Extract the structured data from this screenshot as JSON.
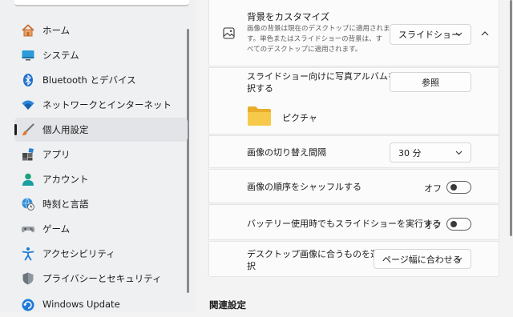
{
  "sidebar": {
    "items": [
      {
        "label": "ホーム",
        "icon": "home-icon"
      },
      {
        "label": "システム",
        "icon": "system-icon"
      },
      {
        "label": "Bluetooth とデバイス",
        "icon": "bluetooth-icon"
      },
      {
        "label": "ネットワークとインターネット",
        "icon": "wifi-icon"
      },
      {
        "label": "個人用設定",
        "icon": "brush-icon",
        "active": true
      },
      {
        "label": "アプリ",
        "icon": "apps-icon"
      },
      {
        "label": "アカウント",
        "icon": "account-icon"
      },
      {
        "label": "時刻と言語",
        "icon": "globe-clock-icon"
      },
      {
        "label": "ゲーム",
        "icon": "gamepad-icon"
      },
      {
        "label": "アクセシビリティ",
        "icon": "accessibility-icon"
      },
      {
        "label": "プライバシーとセキュリティ",
        "icon": "shield-icon"
      },
      {
        "label": "Windows Update",
        "icon": "update-icon"
      }
    ]
  },
  "background": {
    "title": "背景をカスタマイズ",
    "description_lines": [
      "画像の背景は現在のデスクトップに適用されま",
      "す。単色またはスライドショーの背景は、す",
      "べてのデスクトップに適用されます。"
    ],
    "type_value": "スライドショー"
  },
  "album": {
    "label_lines": [
      "スライドショー向けに写真アルバムを選",
      "択する"
    ],
    "browse_label": "参照",
    "folder_name": "ピクチャ"
  },
  "interval": {
    "label": "画像の切り替え間隔",
    "value": "30 分"
  },
  "shuffle": {
    "label": "画像の順序をシャッフルする",
    "state_text": "オフ",
    "on": false
  },
  "battery": {
    "label": "バッテリー使用時でもスライドショーを実行する",
    "state_text": "オフ",
    "on": false
  },
  "fit": {
    "label_lines": [
      "デスクトップ画像に合うものを選",
      "択"
    ],
    "value": "ページ幅に合わせる"
  },
  "related": {
    "heading": "関連設定"
  },
  "colors": {
    "accent": "#0067c0",
    "folder": "#f4c343"
  }
}
